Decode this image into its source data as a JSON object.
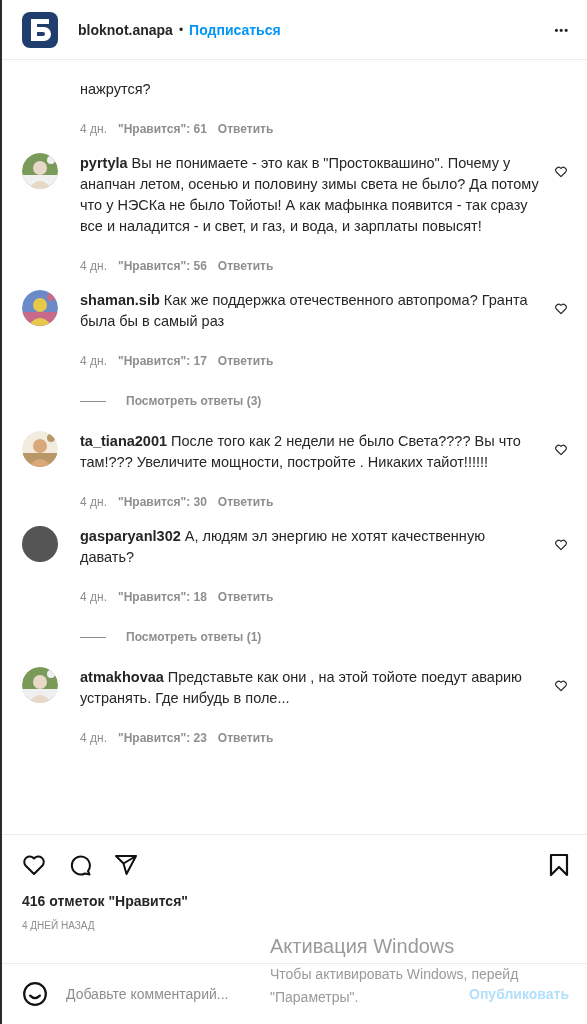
{
  "header": {
    "account": "bloknot.anapa",
    "separator": "•",
    "follow": "Подписаться",
    "more": "•••"
  },
  "comments": [
    {
      "text": "нажрутся?",
      "age": "4 дн.",
      "likes": "\"Нравится\": 61",
      "reply": "Ответить"
    },
    {
      "author": "pyrtyla",
      "text": "Вы не понимаете - это как в \"Простоквашино\". Почему у анапчан летом, осенью и половину зимы света не было? Да потому что у НЭСКа не было Тойоты! А как мафынка появится - так сразу все и наладится - и свет, и газ, и вода, и зарплаты повысят!",
      "age": "4 дн.",
      "likes": "\"Нравится\": 56",
      "reply": "Ответить"
    },
    {
      "author": "shaman.sib",
      "text": "Как же поддержка отечественного автопрома? Гранта была бы в самый раз",
      "age": "4 дн.",
      "likes": "\"Нравится\": 17",
      "reply": "Ответить",
      "replies": "Посмотреть ответы (3)"
    },
    {
      "author": "ta_tiana2001",
      "text": "После того как 2 недели не было Света???? Вы что там!??? Увеличите мощности, постройте . Никаких тайот!!!!!!",
      "age": "4 дн.",
      "likes": "\"Нравится\": 30",
      "reply": "Ответить"
    },
    {
      "author": "gasparyanl302",
      "avatar": {
        "kind": "blank"
      },
      "text": "А, людям эл энергию не хотят качественную давать?",
      "age": "4 дн.",
      "likes": "\"Нравится\": 18",
      "reply": "Ответить",
      "replies": "Посмотреть ответы (1)"
    },
    {
      "author": "atmakhovaa",
      "text": "Представьте как они , на этой тойоте поедут аварию устранять. Где нибудь в поле...",
      "age": "4 дн.",
      "likes": "\"Нравится\": 23",
      "reply": "Ответить"
    }
  ],
  "post": {
    "likes": "416 отметок \"Нравится\"",
    "date": "4 ДНЕЙ НАЗАД"
  },
  "comment_box": {
    "placeholder": "Добавьте комментарий...",
    "submit": "Опубликовать",
    "disabled": true
  },
  "activation_notice": {
    "title": "Активация Windows",
    "line_1": "Чтобы активировать Windows, перейд",
    "line_2": "\"Параметры\"."
  }
}
